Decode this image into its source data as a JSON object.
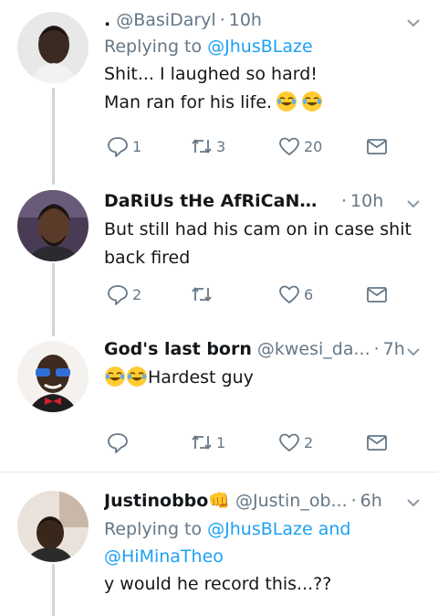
{
  "tweets": [
    {
      "name": ".",
      "handle": "@BasiDaryl",
      "time": "10h",
      "reply_prefix": "Replying to ",
      "reply_to": "@JhusBLaze",
      "reply_extra": "",
      "lines": [
        "Shit... I laughed so hard!",
        "Man ran for his life."
      ],
      "emoji": "grinning-tears-face",
      "replies": "1",
      "retweets": "3",
      "likes": "20"
    },
    {
      "name": "DaRiUs tHe AfRiCaN™🇺🇬...",
      "handle": "",
      "time": "10h",
      "lines": [
        "But still had his cam on in case shit",
        "back fired"
      ],
      "replies": "2",
      "retweets": "",
      "likes": "6"
    },
    {
      "name": "God's last born",
      "handle": "@kwesi_da...",
      "time": "7h",
      "lines": [
        "Hardest guy"
      ],
      "replies": "",
      "retweets": "1",
      "likes": "2"
    },
    {
      "name": "Justinobbo👊",
      "handle": "@Justin_ob...",
      "time": "6h",
      "reply_prefix": "Replying to ",
      "reply_to": "@JhusBLaze",
      "reply_and": " and",
      "reply_to_2": "@HiMinaTheo",
      "lines": [
        "y would he record this...??"
      ]
    }
  ],
  "separator": "·",
  "colors": {
    "link": "#1da1f2",
    "muted": "#657786",
    "thread": "#ccd6dd",
    "divider": "#e1e8ed"
  }
}
